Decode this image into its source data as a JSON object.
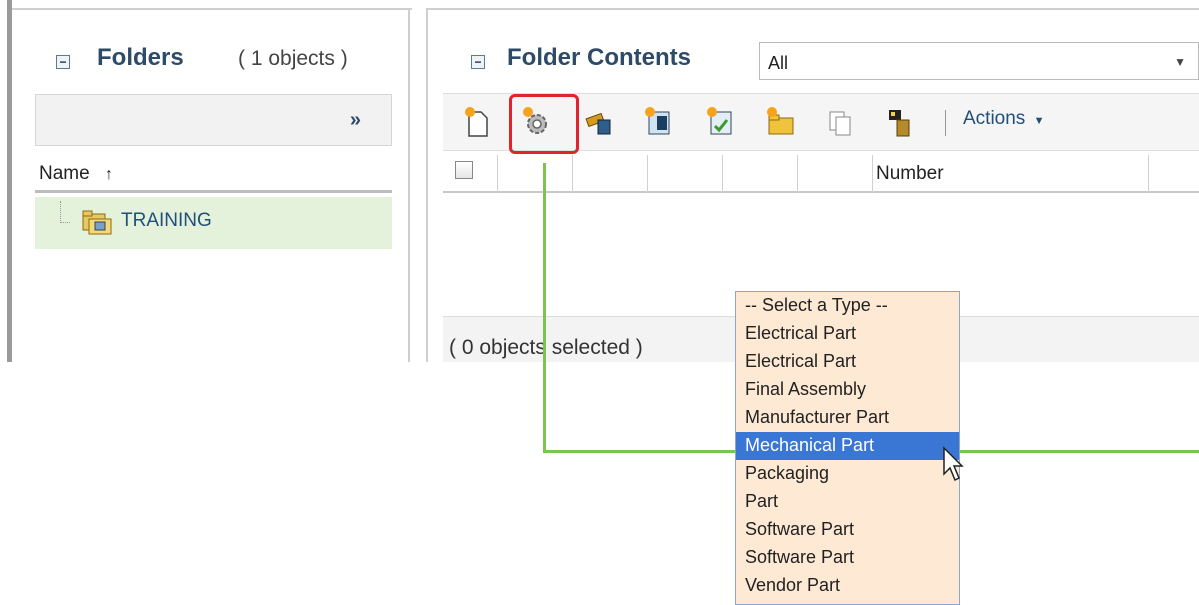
{
  "folders_panel": {
    "title": "Folders",
    "count": "( 1 objects )",
    "expand_icon": "double-chevron-right-icon",
    "name_column": "Name",
    "sort_icon": "arrow-up-icon",
    "items": [
      {
        "label": "TRAINING",
        "icon": "folder-icon"
      }
    ]
  },
  "contents_panel": {
    "title": "Folder Contents",
    "view_select": {
      "value": "All"
    },
    "toolbar": {
      "icons": [
        "new-document-icon",
        "new-part-icon",
        "wrench-icon",
        "table-icon",
        "checklist-icon",
        "new-folder-icon",
        "copy-icon",
        "paste-icon"
      ],
      "actions_label": "Actions"
    },
    "grid": {
      "columns": [
        "",
        "",
        "",
        "",
        "",
        "",
        "Number"
      ]
    },
    "footer": {
      "selection_text": "( 0 objects selected )"
    }
  },
  "type_dropdown": {
    "options": [
      "-- Select a Type --",
      "Electrical Part",
      "Electrical Part",
      "Final Assembly",
      "Manufacturer Part",
      "Mechanical Part",
      "Packaging",
      "Part",
      "Software Part",
      "Software Part",
      "Vendor Part"
    ],
    "selected": "Mechanical Part"
  },
  "colors": {
    "highlight_box": "#e1242b",
    "callout_line": "#7dc44a",
    "dropdown_bg": "#fde9d4",
    "selected_option": "#3a76d4",
    "folder_row": "#e4f2dc"
  }
}
